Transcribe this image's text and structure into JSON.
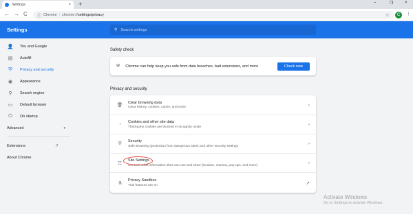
{
  "browser": {
    "tab_title": "Settings",
    "tab_close": "×",
    "new_tab": "+",
    "window_controls": [
      "–",
      "❐",
      "×"
    ],
    "nav": {
      "back": "←",
      "forward": "→",
      "reload": "C"
    },
    "omnibox": {
      "site_label": "Chrome",
      "separator": "|",
      "url_prefix": "chrome://",
      "url_path": "settings/privacy"
    },
    "profile_initial": "C"
  },
  "header": {
    "title": "Settings",
    "search_placeholder": "Search settings"
  },
  "sidebar": {
    "items": [
      {
        "label": "You and Google",
        "icon": "person-icon",
        "glyph": "👤"
      },
      {
        "label": "Autofill",
        "icon": "clipboard-icon",
        "glyph": "▤"
      },
      {
        "label": "Privacy and security",
        "icon": "shield-icon",
        "glyph": "⛨",
        "active": true
      },
      {
        "label": "Appearance",
        "icon": "palette-icon",
        "glyph": "◉"
      },
      {
        "label": "Search engine",
        "icon": "search-icon",
        "glyph": "⚲"
      },
      {
        "label": "Default browser",
        "icon": "browser-icon",
        "glyph": "▭"
      },
      {
        "label": "On startup",
        "icon": "power-icon",
        "glyph": "⏻"
      }
    ],
    "advanced": "Advanced",
    "extensions": "Extensions",
    "about": "About Chrome"
  },
  "main": {
    "safety_check": {
      "title": "Safety check",
      "text": "Chrome can help keep you safe from data breaches, bad extensions, and more",
      "button": "Check now"
    },
    "privacy": {
      "title": "Privacy and security",
      "rows": [
        {
          "title": "Clear browsing data",
          "desc": "Clear history, cookies, cache, and more",
          "icon": "trash-icon",
          "glyph": "🗑"
        },
        {
          "title": "Cookies and other site data",
          "desc": "Third-party cookies are blocked in Incognito mode",
          "icon": "cookie-icon",
          "glyph": "◔"
        },
        {
          "title": "Security",
          "desc": "Safe Browsing (protection from dangerous sites) and other security settings",
          "icon": "shield-icon",
          "glyph": "⛨"
        },
        {
          "title": "Site Settings",
          "desc": "Controls what information sites can use and show (location, camera, pop-ups, and more)",
          "icon": "sliders-icon",
          "glyph": "☷"
        },
        {
          "title": "Privacy Sandbox",
          "desc": "Trial features are on",
          "icon": "external-link-icon",
          "glyph": "↗"
        }
      ]
    }
  },
  "watermark": {
    "line1": "Activate Windows",
    "line2": "Go to Settings to activate Windows."
  },
  "colors": {
    "accent": "#1a73e8",
    "highlight_circle": "#ea4335"
  }
}
